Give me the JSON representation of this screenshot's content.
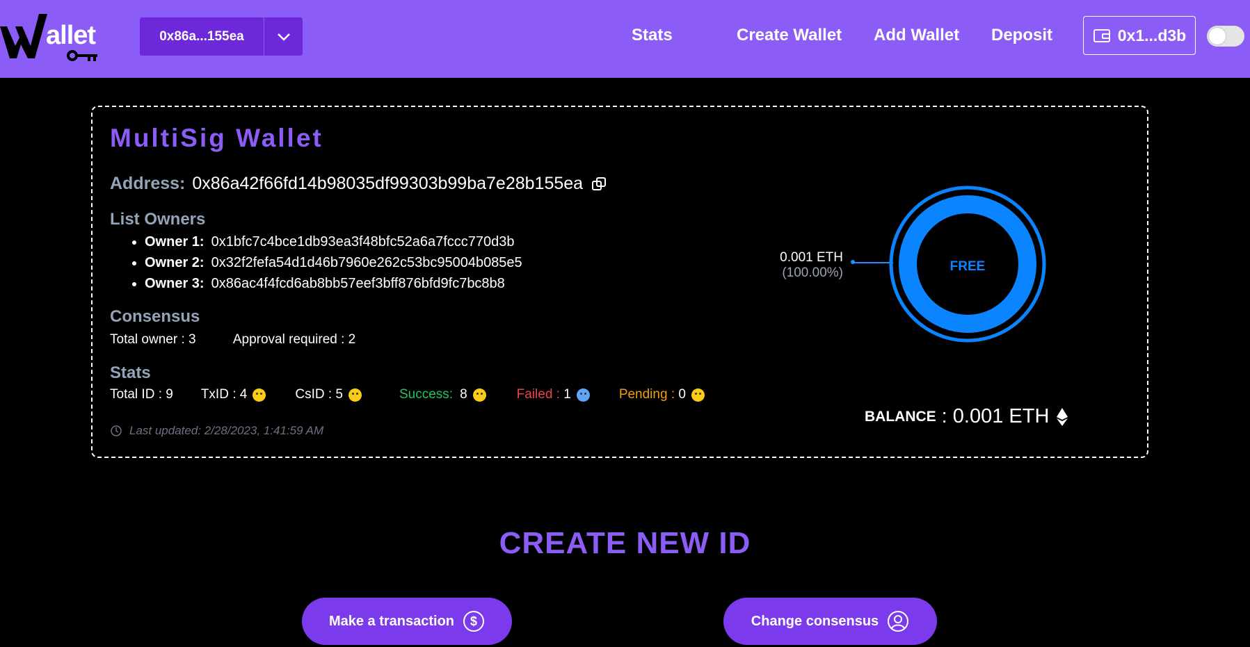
{
  "header": {
    "logo_text": "allet",
    "wallet_selector": "0x86a...155ea",
    "nav": [
      "Stats",
      "Create Wallet",
      "Add Wallet",
      "Deposit"
    ],
    "account": "0x1...d3b",
    "colors": {
      "header_bg": "#8b5cf6",
      "selector_bg": "#6d28d9"
    }
  },
  "wallet": {
    "title": "MultiSig Wallet",
    "address_label": "Address:",
    "address": "0x86a42f66fd14b98035df99303b99ba7e28b155ea",
    "owners_heading": "List Owners",
    "owners": [
      {
        "label": "Owner 1:",
        "address": "0x1bfc7c4bce1db93ea3f48bfc52a6a7fccc770d3b"
      },
      {
        "label": "Owner 2:",
        "address": "0x32f2fefa54d1d46b7960e262c53bc95004b085e5"
      },
      {
        "label": "Owner 3:",
        "address": "0x86ac4f4fcd6ab8bb57eef3bff876bfd9fc7bc8b8"
      }
    ],
    "consensus_heading": "Consensus",
    "total_owner": "Total owner : 3",
    "approval_required": "Approval required : 2",
    "stats_heading": "Stats",
    "stats": {
      "total_id": "Total ID : 9",
      "txid": "TxID : 4",
      "csid": "CsID : 5",
      "success_label": "Success:",
      "success_value": "8",
      "failed_label": "Failed : ",
      "failed_value": "1",
      "pending_label": "Pending : ",
      "pending_value": "0",
      "colors": {
        "success": "#22c55e",
        "failed": "#ef4444",
        "pending": "#f59e0b"
      }
    },
    "last_updated": "Last updated: 2/28/2023, 1:41:59 AM"
  },
  "chart": {
    "slice_label": "FREE",
    "value_label": "0.001 ETH",
    "percent_label": "(100.00%)",
    "color": "#0a84ff"
  },
  "balance": {
    "label": "BALANCE",
    "value": ": 0.001 ETH"
  },
  "create": {
    "title": "CREATE NEW ID",
    "make_transaction": "Make a transaction",
    "change_consensus": "Change consensus"
  }
}
